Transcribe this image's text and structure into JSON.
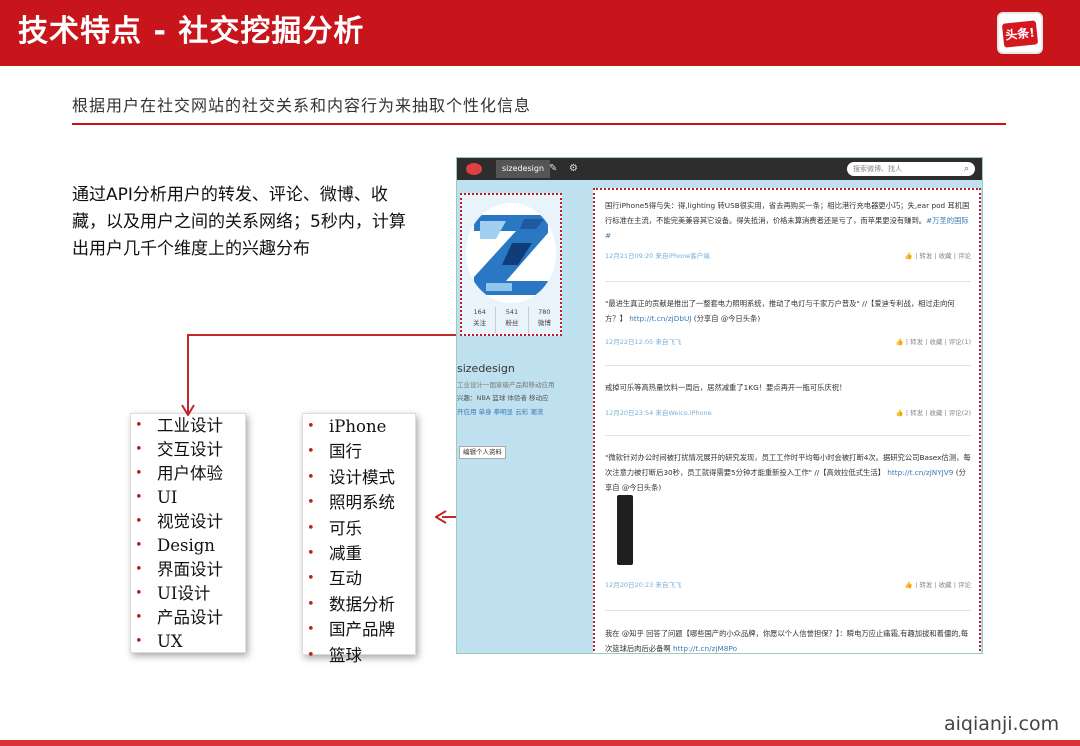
{
  "header": {
    "title": "技术特点 - 社交挖掘分析",
    "logo_text": "头条!"
  },
  "subtitle": "根据用户在社交网站的社交关系和内容行为来抽取个性化信息",
  "description": "通过API分析用户的转发、评论、微博、收藏，以及用户之间的关系网络；5秒内，计算出用户几千个维度上的兴趣分布",
  "left_list": [
    "工业设计",
    "交互设计",
    "用户体验",
    "UI",
    "视觉设计",
    "Design",
    "界面设计",
    "UI设计",
    "产品设计",
    "UX"
  ],
  "right_list": [
    "iPhone",
    "国行",
    "设计模式",
    "照明系统",
    "可乐",
    "减重",
    "互动",
    "数据分析",
    "国产品牌",
    "篮球"
  ],
  "weibo": {
    "username_tab": "sizedesign",
    "search_placeholder": "搜索微博、找人",
    "stats": [
      {
        "value": "164",
        "label": "关注"
      },
      {
        "value": "541",
        "label": "粉丝"
      },
      {
        "value": "780",
        "label": "微博"
      }
    ],
    "profile_name": "sizedesign",
    "profile_desc": "工业设计一国家级产品和移动应用",
    "profile_tags": "兴趣：NBA 篮球 体验者 移动应",
    "profile_tags2": "开应用 单身 拳明显 云彩 潮流",
    "edit_button": "编辑个人资料",
    "posts": [
      {
        "text": "国行iPhone5得与失：得,lighting 转USB很实用，省去再购买一条；相比港行充电器更小巧；失,ear pod 耳机国行标准在主流，不能完美兼容其它设备。得失抵消，价格未算消费者还是亏了，而苹果更没有赚到。",
        "link": "#万圣的国际#",
        "time": "12月21日09:20 来自iPhone客户端",
        "actions": "转发 | 收藏 | 评论"
      },
      {
        "text": "\"最进生真正的贡献是推出了一整套电力照明系统，推动了电灯与千家万户普及\" //【爱迪专利战，相过走向何方？】",
        "link": "http://t.cn/zjDbUJ",
        "suffix": "(分享自 @今日头条)",
        "time": "12月22日12:05 来自飞飞",
        "actions": "转发 | 收藏 | 评论(1)"
      },
      {
        "text": "戒掉可乐等高热量饮料一周后，居然减重了1KG！要点再开一瓶可乐庆祝！",
        "link": "",
        "time": "12月20日23:54 来自Weico.iPhone",
        "actions": "转发 | 收藏 | 评论(2)"
      },
      {
        "text": "\"微软针对办公时间被打扰情况展开的研究发现，员工工作时平均每小时会被打断4次。据研究公司Basex估测，每次注意力被打断后30秒，员工就得需要5分钟才能重新投入工作\" //【高效拉低式生活】",
        "link": "http://t.cn/zjNYJV9",
        "suffix": "(分享自 @今日头条)",
        "time": "12月20日20:23 来自飞飞",
        "actions": "转发 | 收藏 | 评论"
      },
      {
        "text": "我在 @知乎 回答了问题【哪些国产的小众品牌，你愿以个人信誉担保？】：瞬电万应止痛霜,有趣加拔和着僵的,每次篮球后肉后必备啊",
        "link": "http://t.cn/zjM8Po",
        "time": "",
        "actions": ""
      }
    ]
  },
  "watermark": "aiqianji.com",
  "colors": {
    "brand_red": "#c8151b",
    "weibo_bg": "#bfe1ef",
    "link_blue": "#3a7bb5"
  }
}
